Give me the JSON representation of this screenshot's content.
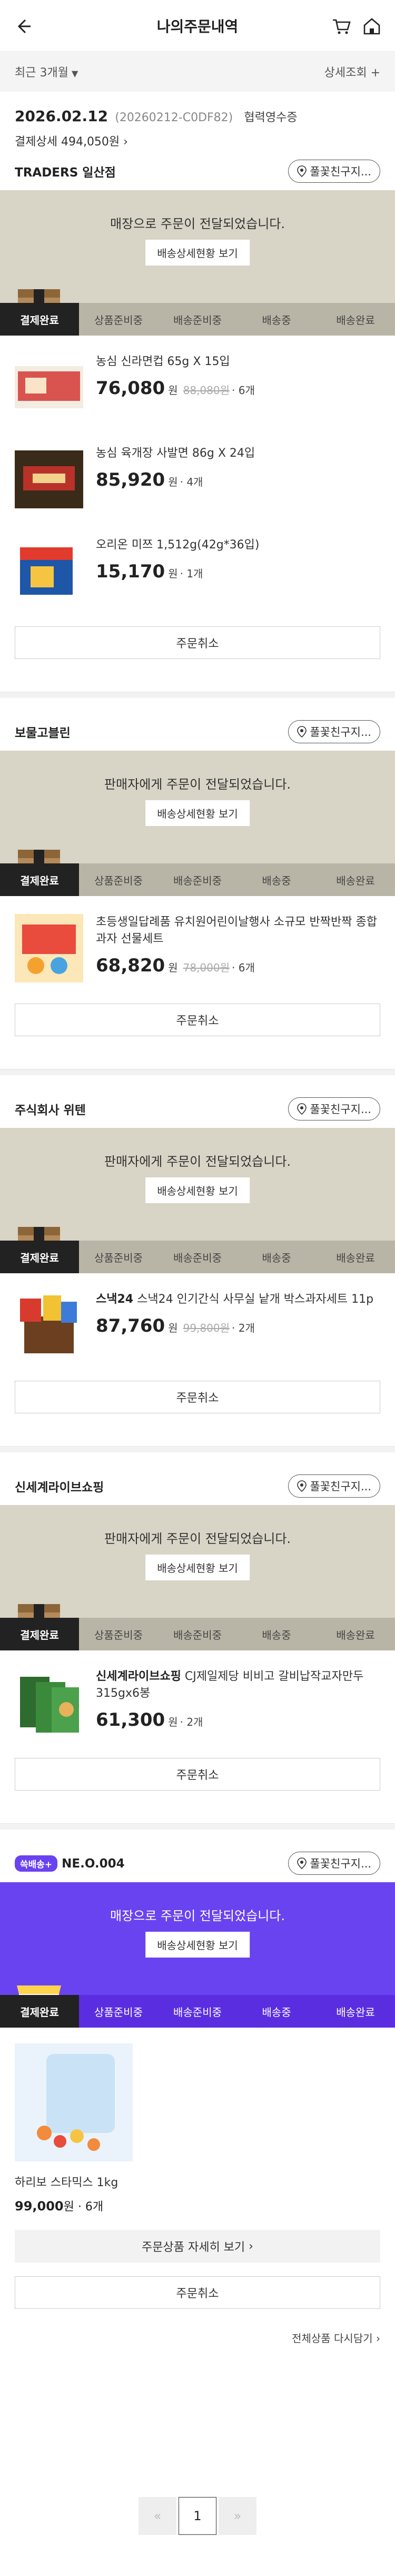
{
  "header": {
    "title": "나의주문내역"
  },
  "filter": {
    "period": "최근 3개월",
    "detail_search": "상세조회"
  },
  "order": {
    "date": "2026.02.12",
    "code": "(20260212-C0DF82)",
    "receipt": "협력영수증",
    "paid": "결제상세 494,050원"
  },
  "common": {
    "gift_btn": "풀꽃친구지...",
    "detail_btn": "배송상세현황 보기",
    "cancel_btn": "주문취소",
    "steps": [
      "결제완료",
      "상품준비중",
      "배송준비중",
      "배송중",
      "배송완료"
    ]
  },
  "sections": [
    {
      "shop": "TRADERS 일산점",
      "message": "매장으로 주문이 전달되었습니다.",
      "items": [
        {
          "name": "농심 신라면컵 65g X 15입",
          "price": "76,080",
          "won": "원",
          "orig": "88,080원",
          "qty": "· 6개"
        },
        {
          "name": "농심 육개장 사발면 86g X 24입",
          "price": "85,920",
          "won": "원",
          "orig": "",
          "qty": "· 4개"
        },
        {
          "name": "오리온 미쯔 1,512g(42g*36입)",
          "price": "15,170",
          "won": "원",
          "orig": "",
          "qty": "· 1개"
        }
      ]
    },
    {
      "shop": "보물고블린",
      "message": "판매자에게 주문이 전달되었습니다.",
      "items": [
        {
          "name": "초등생일답례품 유치원어린이날행사 소규모 반짝반짝 종합과자 선물세트",
          "price": "68,820",
          "won": "원",
          "orig": "78,000원",
          "qty": "· 6개"
        }
      ]
    },
    {
      "shop": "주식회사 위텐",
      "message": "판매자에게 주문이 전달되었습니다.",
      "items": [
        {
          "brand": "스낵24",
          "name": "스낵24 인기간식 사무실 낱개 박스과자세트 11p",
          "price": "87,760",
          "won": "원",
          "orig": "99,800원",
          "qty": "· 2개"
        }
      ]
    },
    {
      "shop": "신세계라이브쇼핑",
      "message": "판매자에게 주문이 전달되었습니다.",
      "items": [
        {
          "brand": "신세계라이브쇼핑",
          "name": "CJ제일제당 비비고 갈비납작교자만두 315gx6봉",
          "price": "61,300",
          "won": "원",
          "orig": "",
          "qty": "· 2개"
        }
      ]
    }
  ],
  "ssg": {
    "badge": "쓱배송+",
    "store_no": "NE.O.004",
    "message": "매장으로 주문이 전달되었습니다.",
    "item_name": "하리보 스타믹스 1kg",
    "price": "99,000",
    "won": "원",
    "qty": "· 6개",
    "detail_more": "주문상품 자세히 보기",
    "reorder": "전체상품 다시담기"
  },
  "pagination": {
    "prev": "«",
    "current": "1",
    "next": "»"
  },
  "colors": {
    "status_bg": "#d8d4c6",
    "ssg_purple": "#6a43f0",
    "active_step": "#222222"
  }
}
